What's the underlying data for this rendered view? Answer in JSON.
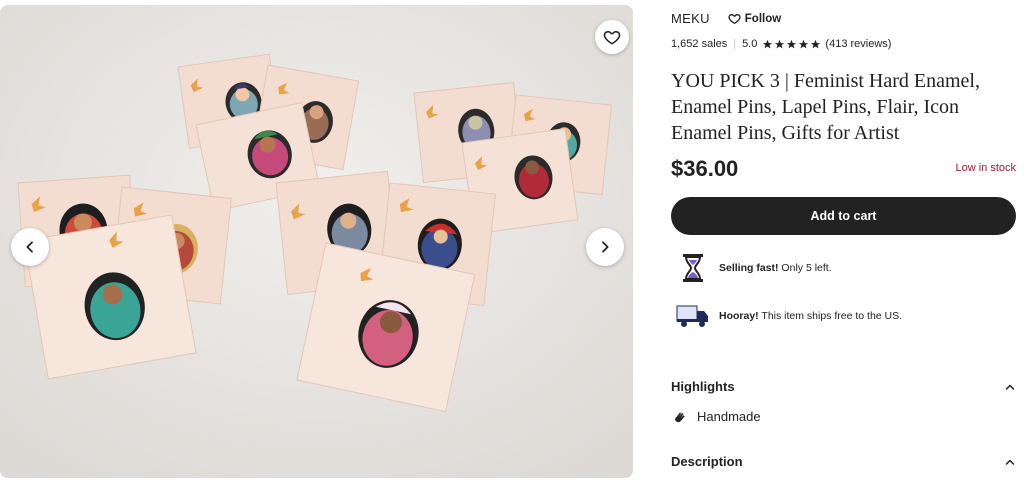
{
  "gallery": {
    "image_alt": "Assorted enamel pins on cards",
    "icons": {
      "favorite": "heart-icon",
      "prev": "chevron-left-icon",
      "next": "chevron-right-icon"
    }
  },
  "shop": {
    "name": "MEKU",
    "follow_label": "Follow",
    "follow_icon": "heart-outline-icon"
  },
  "rating": {
    "sales": "1,652 sales",
    "score": "5.0",
    "stars": 5,
    "reviews": "(413 reviews)",
    "star_color": "#222222"
  },
  "listing": {
    "title": "YOU PICK 3 | Feminist Hard Enamel, Enamel Pins, Lapel Pins, Flair, Icon Enamel Pins, Gifts for Artist",
    "price": "$36.00",
    "stock_status": "Low in stock",
    "stock_color": "#a61a2e"
  },
  "cart": {
    "label": "Add to cart"
  },
  "info": [
    {
      "icon": "hourglass-icon",
      "bold": "Selling fast!",
      "text": " Only 5 left."
    },
    {
      "icon": "delivery-truck-icon",
      "bold": "Hooray!",
      "text": " This item ships free to the US."
    }
  ],
  "sections": {
    "highlights": {
      "label": "Highlights",
      "icon": "chevron-up-icon"
    },
    "highlight_items": [
      {
        "icon": "hand-wave-icon",
        "label": "Handmade"
      }
    ],
    "description": {
      "label": "Description",
      "icon": "chevron-up-icon"
    }
  }
}
